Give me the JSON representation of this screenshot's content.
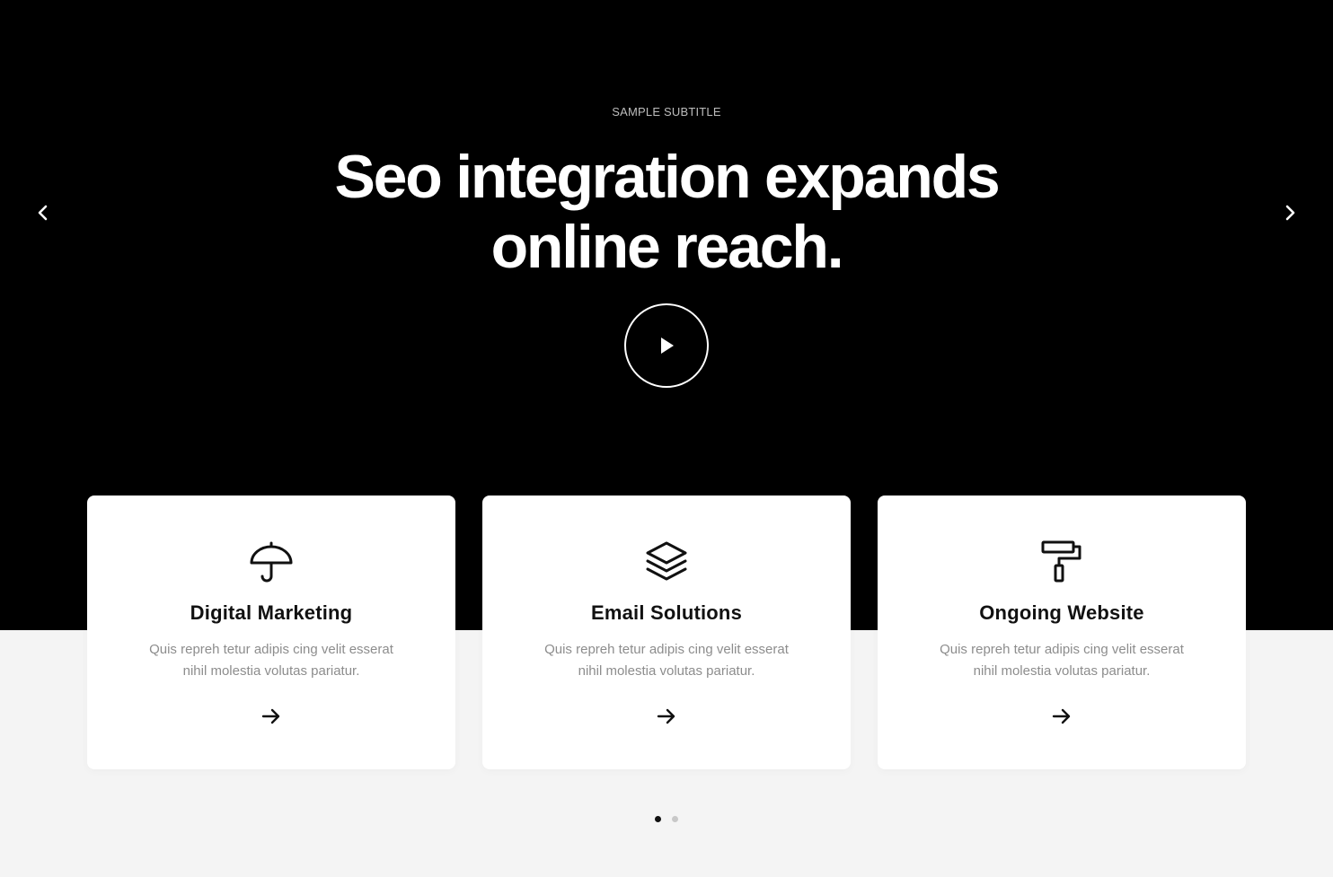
{
  "hero": {
    "subtitle": "SAMPLE SUBTITLE",
    "headline_line1": "Seo integration expands",
    "headline_line2": "online reach.",
    "prev_icon": "chevron-left-icon",
    "next_icon": "chevron-right-icon",
    "play_icon": "play-icon",
    "background": "#000000"
  },
  "cards": [
    {
      "icon": "umbrella-icon",
      "title": "Digital Marketing",
      "description": "Quis repreh tetur adipis cing velit esserat nihil molestia volutas pariatur.",
      "link_icon": "arrow-right-icon"
    },
    {
      "icon": "layers-icon",
      "title": "Email Solutions",
      "description": "Quis repreh tetur adipis cing velit esserat nihil molestia volutas pariatur.",
      "link_icon": "arrow-right-icon"
    },
    {
      "icon": "paint-roller-icon",
      "title": "Ongoing Website",
      "description": "Quis repreh tetur adipis cing velit esserat nihil molestia volutas pariatur.",
      "link_icon": "arrow-right-icon"
    }
  ],
  "pagination": {
    "total": 2,
    "active_index": 0,
    "active_color": "#111111",
    "inactive_color": "#c8c8c8"
  },
  "colors": {
    "lower_background": "#f4f4f4",
    "card_background": "#ffffff",
    "description_text": "#8d8d8d"
  }
}
